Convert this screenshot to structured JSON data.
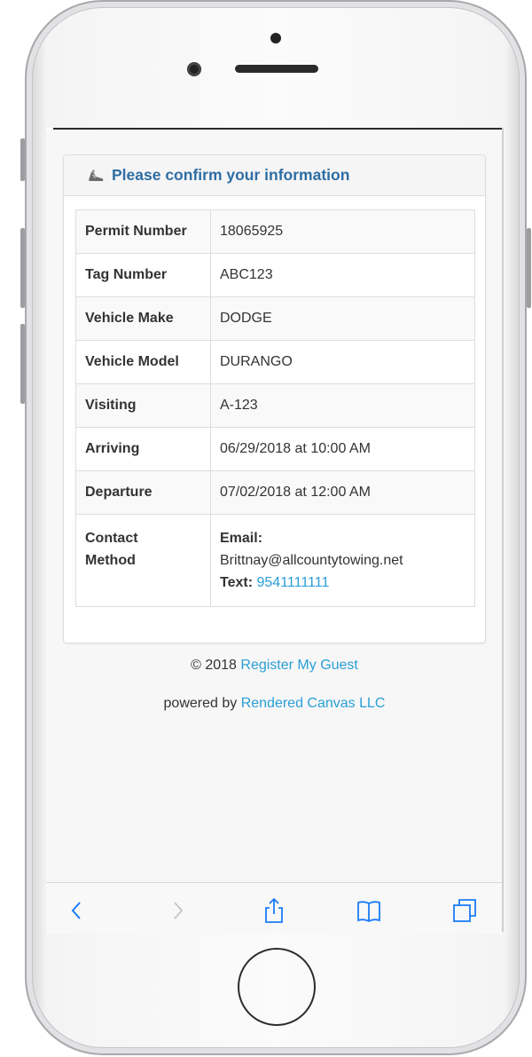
{
  "panel": {
    "title": "Please confirm your information",
    "icon": "sneaker-icon"
  },
  "rows": [
    {
      "label": "Permit Number",
      "value": "18065925"
    },
    {
      "label": "Tag Number",
      "value": "ABC123"
    },
    {
      "label": "Vehicle Make",
      "value": "DODGE"
    },
    {
      "label": "Vehicle Model",
      "value": "DURANGO"
    },
    {
      "label": "Visiting",
      "value": "A-123"
    },
    {
      "label": "Arriving",
      "value": "06/29/2018 at 10:00 AM"
    },
    {
      "label": "Departure",
      "value": "07/02/2018 at 12:00 AM"
    }
  ],
  "contact": {
    "label_line1": "Contact",
    "label_line2": "Method",
    "email_label": "Email:",
    "email_value": "Brittnay@allcountytowing.net",
    "text_label": "Text:",
    "text_value": "9541111111"
  },
  "footer": {
    "copyright": "© 2018",
    "site_link": "Register My Guest",
    "powered_prefix": "powered by",
    "powered_link": "Rendered Canvas LLC"
  },
  "colors": {
    "link": "#2a9fd6",
    "title": "#2e6da4",
    "toolbar_icon": "#1a7cf5"
  }
}
